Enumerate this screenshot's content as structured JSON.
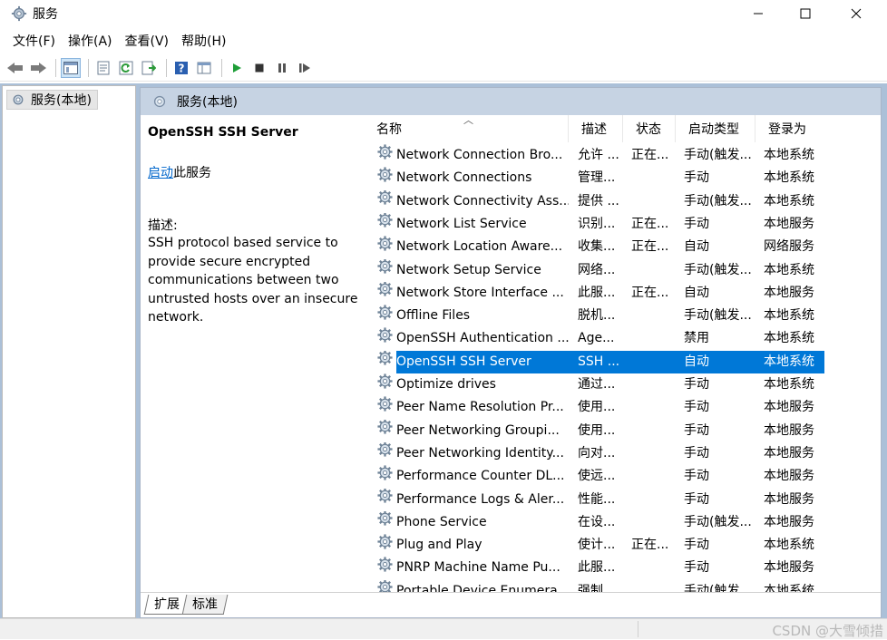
{
  "window": {
    "title": "服务",
    "app_icon": "gear-icon"
  },
  "menu": [
    "文件(F)",
    "操作(A)",
    "查看(V)",
    "帮助(H)"
  ],
  "toolbar_icons": [
    "back-arrow-icon",
    "forward-arrow-icon",
    "console-tree-icon",
    "properties-icon",
    "refresh-icon",
    "export-list-icon",
    "help-icon",
    "view-icon",
    "start-service-icon",
    "stop-service-icon",
    "pause-service-icon",
    "resume-service-icon"
  ],
  "tree": {
    "node_label": "服务(本地)"
  },
  "pane": {
    "header_label": "服务(本地)"
  },
  "details": {
    "service_name": "OpenSSH SSH Server",
    "start_link": "启动",
    "start_suffix": "此服务",
    "description_label": "描述:",
    "description_text": "SSH protocol based service to provide secure encrypted communications between two untrusted hosts over an insecure network."
  },
  "columns": {
    "name": "名称",
    "desc": "描述",
    "status": "状态",
    "startup": "启动类型",
    "logon": "登录为"
  },
  "rows": [
    {
      "name": "Network Connection Bro...",
      "desc": "允许 ...",
      "status": "正在...",
      "startup": "手动(触发...",
      "logon": "本地系统"
    },
    {
      "name": "Network Connections",
      "desc": "管理...",
      "status": "",
      "startup": "手动",
      "logon": "本地系统"
    },
    {
      "name": "Network Connectivity Ass...",
      "desc": "提供 ...",
      "status": "",
      "startup": "手动(触发...",
      "logon": "本地系统"
    },
    {
      "name": "Network List Service",
      "desc": "识别...",
      "status": "正在...",
      "startup": "手动",
      "logon": "本地服务"
    },
    {
      "name": "Network Location Aware...",
      "desc": "收集...",
      "status": "正在...",
      "startup": "自动",
      "logon": "网络服务"
    },
    {
      "name": "Network Setup Service",
      "desc": "网络...",
      "status": "",
      "startup": "手动(触发...",
      "logon": "本地系统"
    },
    {
      "name": "Network Store Interface ...",
      "desc": "此服...",
      "status": "正在...",
      "startup": "自动",
      "logon": "本地服务"
    },
    {
      "name": "Offline Files",
      "desc": "脱机...",
      "status": "",
      "startup": "手动(触发...",
      "logon": "本地系统"
    },
    {
      "name": "OpenSSH Authentication ...",
      "desc": "Age...",
      "status": "",
      "startup": "禁用",
      "logon": "本地系统"
    },
    {
      "name": "OpenSSH SSH Server",
      "desc": "SSH ...",
      "status": "",
      "startup": "自动",
      "logon": "本地系统",
      "selected": true
    },
    {
      "name": "Optimize drives",
      "desc": "通过...",
      "status": "",
      "startup": "手动",
      "logon": "本地系统"
    },
    {
      "name": "Peer Name Resolution Pr...",
      "desc": "使用...",
      "status": "",
      "startup": "手动",
      "logon": "本地服务"
    },
    {
      "name": "Peer Networking Groupi...",
      "desc": "使用...",
      "status": "",
      "startup": "手动",
      "logon": "本地服务"
    },
    {
      "name": "Peer Networking Identity...",
      "desc": "向对...",
      "status": "",
      "startup": "手动",
      "logon": "本地服务"
    },
    {
      "name": "Performance Counter DL...",
      "desc": "使远...",
      "status": "",
      "startup": "手动",
      "logon": "本地服务"
    },
    {
      "name": "Performance Logs & Aler...",
      "desc": "性能...",
      "status": "",
      "startup": "手动",
      "logon": "本地服务"
    },
    {
      "name": "Phone Service",
      "desc": "在设...",
      "status": "",
      "startup": "手动(触发...",
      "logon": "本地服务"
    },
    {
      "name": "Plug and Play",
      "desc": "使计...",
      "status": "正在...",
      "startup": "手动",
      "logon": "本地系统"
    },
    {
      "name": "PNRP Machine Name Pu...",
      "desc": "此服...",
      "status": "",
      "startup": "手动",
      "logon": "本地服务"
    },
    {
      "name": "Portable Device Enumera...",
      "desc": "强制...",
      "status": "",
      "startup": "手动(触发...",
      "logon": "本地系统"
    }
  ],
  "tabs": {
    "extended": "扩展",
    "standard": "标准"
  },
  "watermark": "CSDN @大雪倾措"
}
